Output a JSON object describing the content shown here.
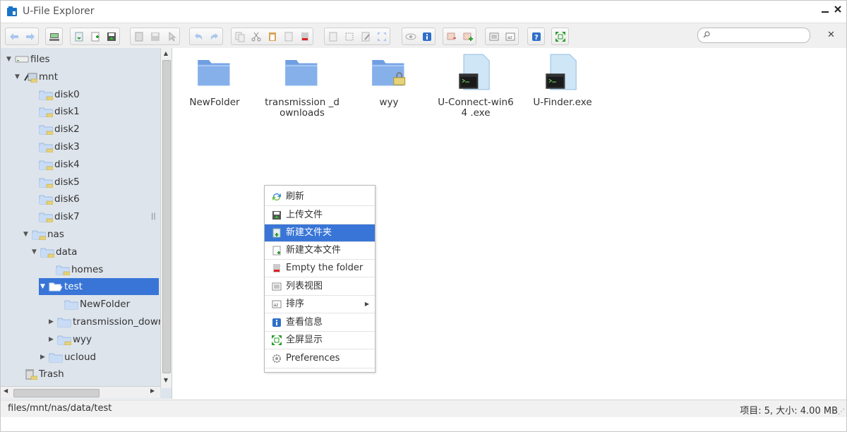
{
  "window": {
    "title": "U-File Explorer"
  },
  "search": {
    "placeholder": ""
  },
  "tree": {
    "items": [
      {
        "label": "files",
        "icon": "drive-icon"
      },
      {
        "label": "mnt",
        "icon": "network-folder-icon"
      },
      {
        "label": "disk0"
      },
      {
        "label": "disk1"
      },
      {
        "label": "disk2"
      },
      {
        "label": "disk3"
      },
      {
        "label": "disk4"
      },
      {
        "label": "disk5"
      },
      {
        "label": "disk6"
      },
      {
        "label": "disk7"
      },
      {
        "label": "nas"
      },
      {
        "label": "data"
      },
      {
        "label": "homes"
      },
      {
        "label": "test",
        "selected": true
      },
      {
        "label": "NewFolder"
      },
      {
        "label": "transmission_down"
      },
      {
        "label": "wyy"
      },
      {
        "label": "ucloud"
      },
      {
        "label": "Trash",
        "icon": "trash-icon"
      }
    ]
  },
  "files": [
    {
      "name": "NewFolder",
      "type": "folder"
    },
    {
      "name": "transmission _downloads",
      "type": "folder"
    },
    {
      "name": "wyy",
      "type": "folder-locked"
    },
    {
      "name": "U-Connect-win64 .exe",
      "type": "executable"
    },
    {
      "name": "U-Finder.exe",
      "type": "executable"
    }
  ],
  "context_menu": {
    "items": [
      {
        "label": "刷新",
        "icon": "refresh-icon"
      },
      {
        "label": "上传文件",
        "icon": "upload-icon"
      },
      {
        "label": "新建文件夹",
        "icon": "new-folder-icon",
        "active": true
      },
      {
        "label": "新建文本文件",
        "icon": "new-text-file-icon"
      },
      {
        "label": "Empty the folder",
        "icon": "empty-folder-icon"
      },
      {
        "label": "列表视图",
        "icon": "list-view-icon"
      },
      {
        "label": "排序",
        "icon": "sort-icon",
        "submenu": true
      },
      {
        "label": "查看信息",
        "icon": "info-icon"
      },
      {
        "label": "全屏显示",
        "icon": "fullscreen-icon"
      },
      {
        "label": "Preferences",
        "icon": "gear-icon"
      }
    ]
  },
  "status": {
    "path": "files/mnt/nas/data/test",
    "info": "项目: 5, 大小: 4.00 MB"
  },
  "colors": {
    "selection": "#3875d7",
    "sidebar_bg": "#dde4ec",
    "folder": "#7ea8e6"
  }
}
